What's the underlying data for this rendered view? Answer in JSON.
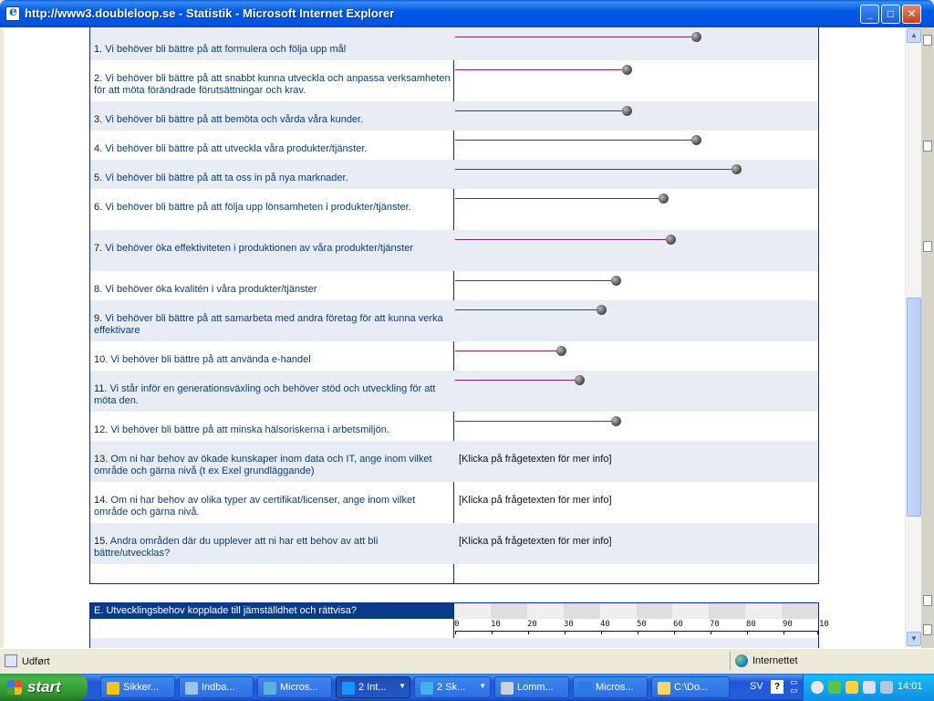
{
  "window": {
    "title": "http://www3.doubleloop.se - Statistik - Microsoft Internet Explorer",
    "minimize": "_",
    "maximize": "□",
    "close": "✕"
  },
  "survey": {
    "scale_max": 100,
    "questions": [
      {
        "num": "1.",
        "text": "Vi behöver bli bättre på att formulera och följa upp mål",
        "value": 66
      },
      {
        "num": "2.",
        "text": "Vi behöver bli bättre på att snabbt kunna utveckla och anpassa verksamheten för att möta förändrade förutsättningar och krav.",
        "value": 47
      },
      {
        "num": "3.",
        "text": "Vi behöver bli bättre på att bemöta och vårda våra kunder.",
        "value": 47
      },
      {
        "num": "4.",
        "text": "Vi behöver bli bättre på att utveckla våra produkter/tjänster.",
        "value": 66
      },
      {
        "num": "5.",
        "text": "Vi behöver bli bättre på att ta oss in på nya marknader.",
        "value": 77
      },
      {
        "num": "6.",
        "text": "Vi behöver bli bättre på att följa upp lönsamheten i produkter/tjänster.",
        "value": 57
      },
      {
        "num": "7.",
        "text": "Vi behöver öka effektiviteten i produktionen av våra produkter/tjänster",
        "value": 59
      },
      {
        "num": "8.",
        "text": "Vi behöver öka kvalitén i våra produkter/tjänster",
        "value": 44
      },
      {
        "num": "9.",
        "text": "Vi behöver bli bättre på att samarbeta med andra företag för att kunna verka effektivare",
        "value": 40
      },
      {
        "num": "10.",
        "text": "Vi behöver bli bättre på att använda e-handel",
        "value": 29
      },
      {
        "num": "11.",
        "text": "Vi står inför en generationsväxling och behöver stöd och utveckling för att möta den.",
        "value": 34
      },
      {
        "num": "12.",
        "text": "Vi behöver bli bättre på att minska hälsoriskerna i arbetsmiljön.",
        "value": 44
      },
      {
        "num": "13.",
        "text": "Om ni har behov av ökade kunskaper inom data och IT, ange inom vilket område och gärna nivå (t ex Exel grundläggande)",
        "info": "[Klicka på frågetexten för mer info]"
      },
      {
        "num": "14.",
        "text": "Om ni har behov av olika typer av certifikat/licenser, ange inom vilket område och gärna nivå.",
        "info": "[Klicka på frågetexten för mer info]"
      },
      {
        "num": "15.",
        "text": "Andra områden där du upplever att ni har ett behov av att bli bättre/utvecklas?",
        "info": "[Klicka på frågetexten för mer info]"
      }
    ]
  },
  "section_e": {
    "heading": "E. Utvecklingsbehov kopplade till jämställdhet och rättvisa?",
    "ticks": [
      "0",
      "10",
      "20",
      "30",
      "40",
      "50",
      "60",
      "70",
      "80",
      "90",
      "10"
    ]
  },
  "statusbar": {
    "status": "Udført",
    "zone": "Internettet"
  },
  "taskbar": {
    "start": "start",
    "tasks": [
      {
        "label": "Sikker...",
        "color": "#F0C419"
      },
      {
        "label": "Indba...",
        "color": "#9FC3F0"
      },
      {
        "label": "Micros...",
        "color": "#5BB0E0"
      },
      {
        "label": "2 Int...",
        "color": "#1E90FF",
        "active": true,
        "caret": "▼"
      },
      {
        "label": "2 Sk...",
        "color": "#3FB0F0",
        "caret": "▼"
      },
      {
        "label": "Lomm...",
        "color": "#C9D3E0"
      },
      {
        "label": "Micros...",
        "color": "#2B7AE0"
      },
      {
        "label": "C:\\Do...",
        "color": "#F5D76E"
      }
    ],
    "lang": "SV",
    "help": "?",
    "clock": "14:01"
  }
}
